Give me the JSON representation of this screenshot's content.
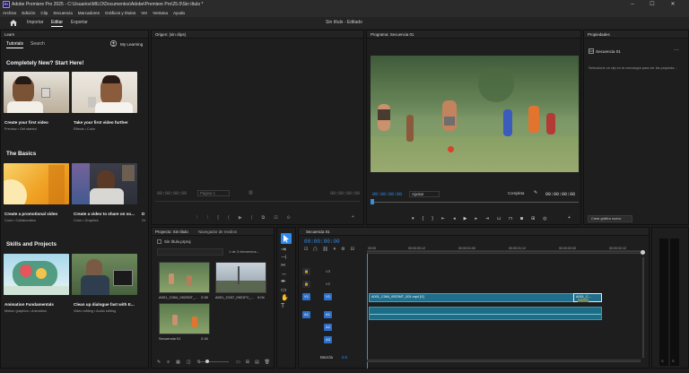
{
  "window": {
    "title": "Adobe Premiere Pro 2025 - C:\\Usuarios\\MILO\\Documentos\\Adobe\\Premiere Pro\\25.0\\Sin título *",
    "minimize": "–",
    "maximize": "☐",
    "close": "✕"
  },
  "menu": [
    "Archivo",
    "Edición",
    "Clip",
    "Secuencia",
    "Marcadores",
    "Gráficos y títulos",
    "Ver",
    "Ventana",
    "Ayuda"
  ],
  "topnav": {
    "home_icon": "home-icon",
    "import": "Importar",
    "edit": "Editar",
    "export": "Exportar",
    "project_title": "Sin título - Editado"
  },
  "learn": {
    "panel_title": "Learn",
    "tabs": [
      "Tutorials",
      "Search"
    ],
    "my_learning": "My Learning",
    "sections": [
      {
        "heading": "Completely New? Start Here!",
        "cards": [
          {
            "title": "Create your first video",
            "sub": "Preview  •  Get started"
          },
          {
            "title": "Take your first video further",
            "sub": "Effects  •  Color"
          }
        ]
      },
      {
        "heading": "The Basics",
        "cards": [
          {
            "title": "Create a promotional video",
            "sub": "Color  •  Collaboration"
          },
          {
            "title": "Create a video to share on so...",
            "sub": "Color  •  Graphics"
          }
        ]
      },
      {
        "heading": "Skills and Projects",
        "cards": [
          {
            "title": "Animation Fundamentals",
            "sub": "Motion graphics  •  Animation"
          },
          {
            "title": "Clean up dialogue fast with E...",
            "sub": "Video editing  •  Audio editing"
          }
        ]
      }
    ],
    "cut_letter": "D",
    "cut_sub": "Gr"
  },
  "source": {
    "panel_title": "Origen: (sin clips)",
    "timecode_left": "00:00:00:00",
    "page": "Página 1",
    "timecode_right": "00:00:00:00"
  },
  "program": {
    "panel_title": "Programa: Secuencia 01",
    "timecode_left": "00:00:00:00",
    "fit": "Ajustar",
    "quality": "Completa",
    "timecode_right": "00:00:00:08"
  },
  "properties": {
    "panel_title": "Propiedades",
    "item": "Secuencia 01",
    "hint": "Seleccione un clip en la cronología para ver las propieda...",
    "create_graphic": "Crear gráfico nuevo"
  },
  "project": {
    "panel_title": "Proyecto: Sin título",
    "tab2": "Navegador de medios",
    "file": "Sin título.prproj",
    "selection": "1 de 3 elementos...",
    "items": [
      {
        "name": "A001_C064_0922MT_...",
        "duration": "2:08"
      },
      {
        "name": "A001_C037_0921FC_...",
        "duration": "0:04"
      },
      {
        "name": "Secuencia 01",
        "duration": "2:16"
      }
    ]
  },
  "timeline": {
    "panel_title": "Secuencia 01",
    "timecode": "00:00:00:00",
    "ruler": [
      "00:00",
      "00:00:00:12",
      "00:00:01:00",
      "00:00:01:12",
      "00:00:02:00",
      "00:00:02:12"
    ],
    "tracks_video": [
      "V3",
      "V2",
      "V1"
    ],
    "tracks_audio": [
      "A1",
      "A2",
      "A3"
    ],
    "src_v": "V1",
    "src_a": "A1",
    "clip1": "A001_C064_0922MT_001.mp4 [V]",
    "clip2": "A001_C...",
    "mix": "Mezcla",
    "mix_value": "0.0"
  },
  "colors": {
    "accent": "#2d8ceb",
    "clip_video": "#1f6e8c",
    "clip_audio": "#1b6e86",
    "playhead": "#3a8dde"
  }
}
